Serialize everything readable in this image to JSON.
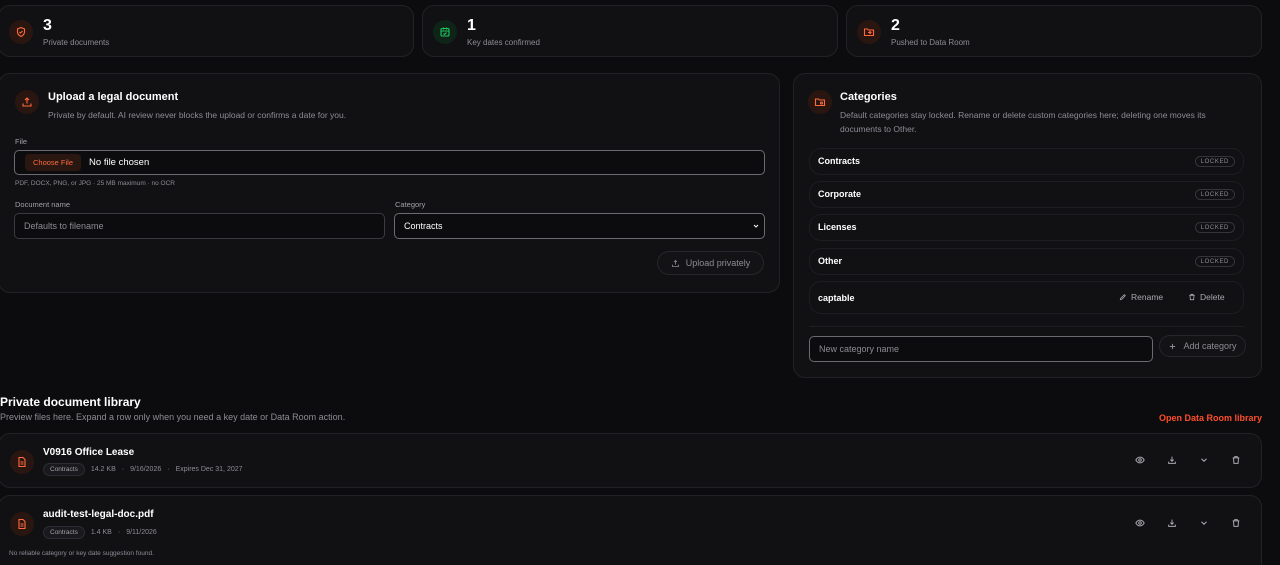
{
  "stats": [
    {
      "value": "3",
      "label": "Private documents",
      "icon": "shield-icon",
      "accent": "#ff6a3d"
    },
    {
      "value": "1",
      "label": "Key dates confirmed",
      "icon": "calendar-check-icon",
      "accent": "#22c55e"
    },
    {
      "value": "2",
      "label": "Pushed to Data Room",
      "icon": "folder-arrow-icon",
      "accent": "#ff6a3d"
    }
  ],
  "upload": {
    "title": "Upload a legal document",
    "subtitle": "Private by default. AI review never blocks the upload or confirms a date for you.",
    "file_label": "File",
    "choose_label": "Choose File",
    "file_status": "No file chosen",
    "file_hint": "PDF, DOCX, PNG, or JPG · 25 MB maximum · no OCR",
    "name_label": "Document name",
    "name_placeholder": "Defaults to filename",
    "category_label": "Category",
    "category_value": "Contracts",
    "submit_label": "Upload privately"
  },
  "categories": {
    "title": "Categories",
    "subtitle": "Default categories stay locked. Rename or delete custom categories here; deleting one moves its documents to Other.",
    "locked_label": "LOCKED",
    "items": [
      {
        "name": "Contracts"
      },
      {
        "name": "Corporate"
      },
      {
        "name": "Licenses"
      },
      {
        "name": "Other"
      },
      {
        "name": "captable"
      }
    ],
    "rename_label": "Rename",
    "delete_label": "Delete",
    "new_placeholder": "New category name",
    "add_label": "Add category"
  },
  "library": {
    "title": "Private document library",
    "subtitle": "Preview files here. Expand a row only when you need a key date or Data Room action.",
    "open_link": "Open Data Room library",
    "docs": [
      {
        "title": "V0916 Office Lease",
        "tag": "Contracts",
        "size": "14.2 KB",
        "date": "9/16/2026",
        "expires": "Expires Dec 31, 2027",
        "note": ""
      },
      {
        "title": "audit-test-legal-doc.pdf",
        "tag": "Contracts",
        "size": "1.4 KB",
        "date": "9/11/2026",
        "expires": "",
        "note": "No reliable category or key date suggestion found."
      }
    ]
  },
  "colors": {
    "background": "#0c0c0e",
    "card": "#111114",
    "accent": "#ff6a3d",
    "link": "#ff4d2a",
    "success": "#22c55e"
  }
}
